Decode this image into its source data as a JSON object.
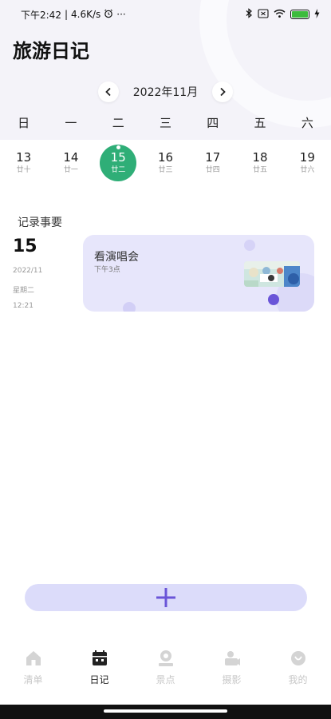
{
  "status_bar": {
    "time": "下午2:42",
    "network_speed": "4.6K/s",
    "more": "···"
  },
  "app_title": "旅游日记",
  "calendar": {
    "month_label": "2022年11月",
    "weekdays": [
      "日",
      "一",
      "二",
      "三",
      "四",
      "五",
      "六"
    ],
    "days": [
      {
        "num": "13",
        "lunar": "廿十"
      },
      {
        "num": "14",
        "lunar": "廿一"
      },
      {
        "num": "15",
        "lunar": "廿二"
      },
      {
        "num": "16",
        "lunar": "廿三"
      },
      {
        "num": "17",
        "lunar": "廿四"
      },
      {
        "num": "18",
        "lunar": "廿五"
      },
      {
        "num": "19",
        "lunar": "廿六"
      }
    ],
    "selected_day": "15"
  },
  "records": {
    "section_title": "记录事要",
    "day": "15",
    "date": "2022/11",
    "weekday": "星期二",
    "time": "12:21",
    "card": {
      "title": "看演唱会",
      "subtitle": "下午3点"
    }
  },
  "colors": {
    "accent_green": "#2fae77",
    "accent_purple": "#6a55d8",
    "card_bg": "#e7e6fb",
    "add_button_bg": "#dcdcfa"
  },
  "bottom_nav": [
    {
      "label": "清单",
      "icon": "home-icon",
      "active": false
    },
    {
      "label": "日记",
      "icon": "calendar-icon",
      "active": true
    },
    {
      "label": "景点",
      "icon": "location-pin-icon",
      "active": false
    },
    {
      "label": "摄影",
      "icon": "camera-icon",
      "active": false
    },
    {
      "label": "我的",
      "icon": "profile-icon",
      "active": false
    }
  ]
}
